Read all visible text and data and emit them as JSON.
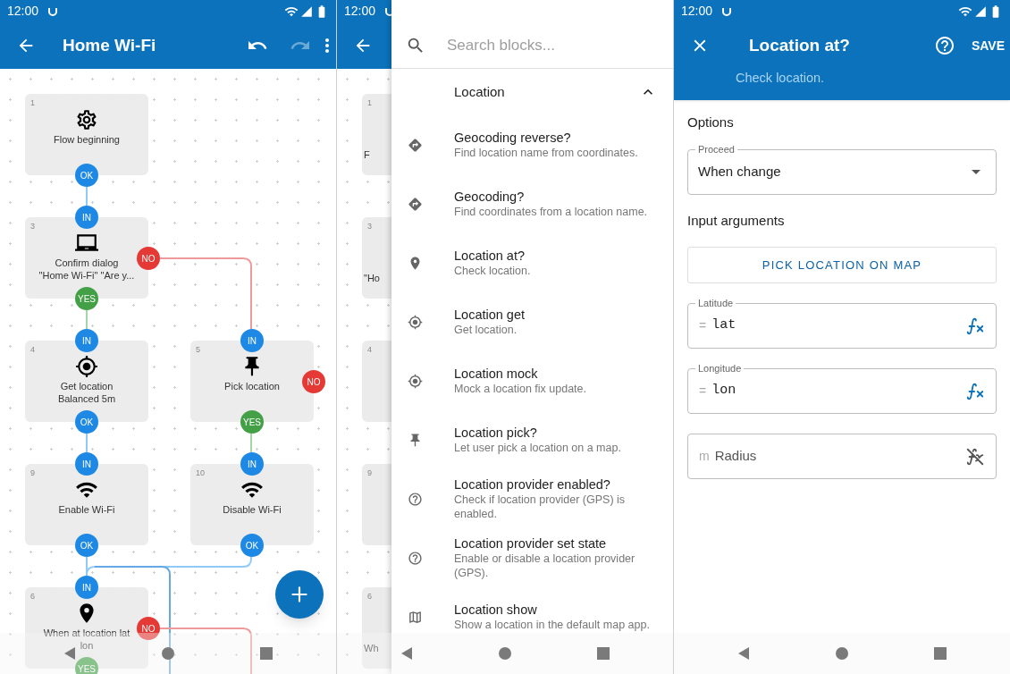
{
  "flow_screen": {
    "status_bar": {
      "time": "12:00"
    },
    "toolbar": {
      "title": "Home Wi-Fi",
      "undo": {
        "disabled": false
      },
      "redo": {
        "disabled": true
      }
    },
    "nodes": [
      {
        "number": "1",
        "kind": "gear",
        "lines": [
          "Flow beginning"
        ],
        "ports": [
          {
            "label": "OK",
            "kind": "ok"
          }
        ]
      },
      {
        "number": "3",
        "kind": "confirm",
        "lines": [
          "Confirm dialog",
          "\"Home Wi-Fi\" \"Are y..."
        ],
        "ports": [
          {
            "label": "IN",
            "kind": "in"
          },
          {
            "label": "NO",
            "kind": "no"
          },
          {
            "label": "YES",
            "kind": "yes"
          }
        ]
      },
      {
        "number": "4",
        "kind": "crosshair",
        "lines": [
          "Get location",
          "Balanced 5m"
        ],
        "ports": [
          {
            "label": "IN",
            "kind": "in"
          },
          {
            "label": "OK",
            "kind": "ok"
          }
        ]
      },
      {
        "number": "5",
        "kind": "pushpin",
        "lines": [
          "Pick location"
        ],
        "ports": [
          {
            "label": "IN",
            "kind": "in"
          },
          {
            "label": "NO",
            "kind": "no"
          },
          {
            "label": "YES",
            "kind": "yes"
          }
        ]
      },
      {
        "number": "9",
        "kind": "wifi",
        "lines": [
          "Enable Wi-Fi"
        ],
        "ports": [
          {
            "label": "IN",
            "kind": "in"
          },
          {
            "label": "OK",
            "kind": "ok"
          }
        ]
      },
      {
        "number": "10",
        "kind": "wifi",
        "lines": [
          "Disable Wi-Fi"
        ],
        "ports": [
          {
            "label": "IN",
            "kind": "in"
          },
          {
            "label": "OK",
            "kind": "ok"
          }
        ]
      },
      {
        "number": "6",
        "kind": "pin",
        "lines": [
          "When at location lat",
          "lon"
        ],
        "ports": [
          {
            "label": "IN",
            "kind": "in"
          },
          {
            "label": "NO",
            "kind": "no"
          },
          {
            "label": "YES",
            "kind": "yes"
          }
        ]
      }
    ]
  },
  "picker_screen": {
    "status_bar": {
      "time": "12:00"
    },
    "background_nodes": [
      {
        "number": "1",
        "text": "F"
      },
      {
        "number": "3",
        "text": "\"Ho"
      },
      {
        "number": "4"
      },
      {
        "number": "9"
      },
      {
        "number": "6",
        "text": "Wh"
      }
    ],
    "drawer": {
      "search": {
        "placeholder": "Search blocks..."
      },
      "section": {
        "title": "Location",
        "expanded": true
      },
      "items": [
        {
          "kind": "geocode",
          "title": "Geocoding reverse?",
          "description": "Find location name from coordinates."
        },
        {
          "kind": "geocode",
          "title": "Geocoding?",
          "description": "Find coordinates from a location name."
        },
        {
          "kind": "pin",
          "title": "Location at?",
          "description": "Check location."
        },
        {
          "kind": "crosshair",
          "title": "Location get",
          "description": "Get location."
        },
        {
          "kind": "crosshair",
          "title": "Location mock",
          "description": "Mock a location fix update."
        },
        {
          "kind": "pushpin",
          "title": "Location pick?",
          "description": "Let user pick a location on a map."
        },
        {
          "kind": "provider",
          "title": "Location provider enabled?",
          "description": "Check if location provider (GPS) is enabled."
        },
        {
          "kind": "provider",
          "title": "Location provider set state",
          "description": "Enable or disable a location provider (GPS)."
        },
        {
          "kind": "map",
          "title": "Location show",
          "description": "Show a location in the default map app."
        }
      ]
    }
  },
  "editor_screen": {
    "status_bar": {
      "time": "12:00"
    },
    "header": {
      "title": "Location at?",
      "subtitle": "Check location.",
      "save": "SAVE"
    },
    "options_heading": "Options",
    "proceed": {
      "label": "Proceed",
      "value": "When change"
    },
    "arguments_heading": "Input arguments",
    "map_button": "PICK LOCATION ON MAP",
    "fields": [
      {
        "label": "Latitude",
        "prefix": "=",
        "value": "lat",
        "expression": true
      },
      {
        "label": "Longitude",
        "prefix": "=",
        "value": "lon",
        "expression": true
      },
      {
        "prefix": "m",
        "placeholder": "Radius",
        "expression": false
      }
    ]
  }
}
